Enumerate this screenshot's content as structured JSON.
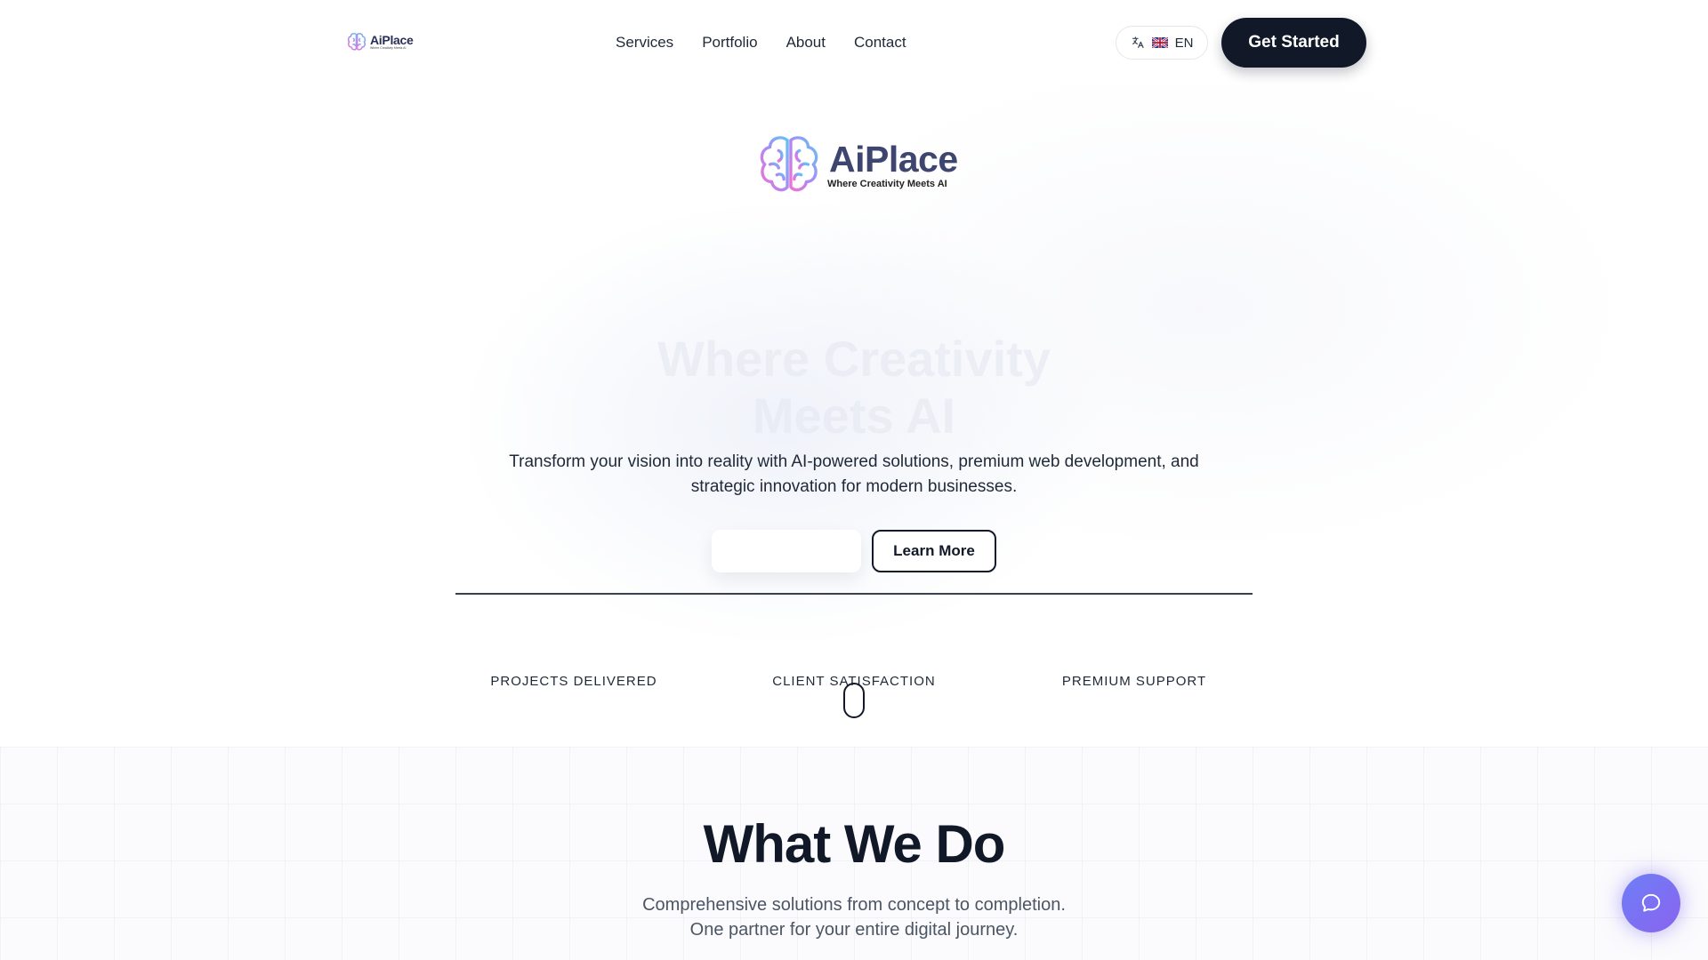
{
  "header": {
    "logo_name": "AiPlace",
    "logo_tagline": "Where Creativity Meets AI",
    "nav": [
      {
        "label": "Services"
      },
      {
        "label": "Portfolio"
      },
      {
        "label": "About"
      },
      {
        "label": "Contact"
      }
    ],
    "language": {
      "flag": "uk-flag-icon",
      "code": "EN"
    },
    "cta_label": "Get Started"
  },
  "hero": {
    "logo_name": "AiPlace",
    "logo_tagline": "Where Creativity Meets AI",
    "title_line1": "Where Creativity",
    "title_line2": "Meets AI",
    "description": "Transform your vision into reality with AI-powered solutions, premium web development, and strategic innovation for modern businesses.",
    "learn_more_label": "Learn More",
    "stats": [
      {
        "label": "PROJECTS DELIVERED"
      },
      {
        "label": "CLIENT SATISFACTION"
      },
      {
        "label": "PREMIUM SUPPORT"
      }
    ]
  },
  "section": {
    "title": "What We Do",
    "subtitle_line1": "Comprehensive solutions from concept to completion.",
    "subtitle_line2": "One partner for your entire digital journey."
  },
  "colors": {
    "primary_dark": "#111827",
    "chat_gradient_start": "#6d7ff5",
    "chat_gradient_end": "#8a63f0",
    "brain_gradient": [
      "#f472d0",
      "#60c6f0"
    ]
  }
}
